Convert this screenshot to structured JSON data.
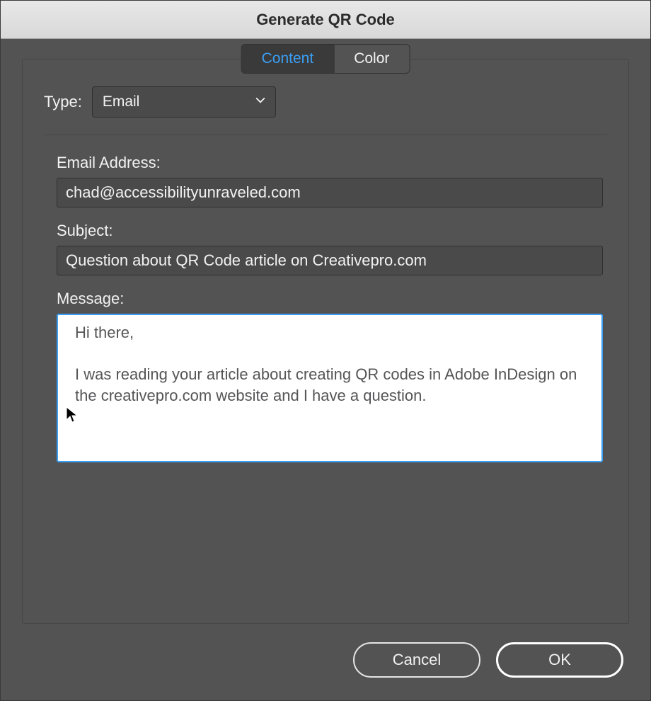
{
  "title": "Generate QR Code",
  "tabs": {
    "content": "Content",
    "color": "Color",
    "active": "content"
  },
  "type": {
    "label": "Type:",
    "selected": "Email"
  },
  "fields": {
    "emailLabel": "Email Address:",
    "emailValue": "chad@accessibilityunraveled.com",
    "subjectLabel": "Subject:",
    "subjectValue": "Question about QR Code article on Creativepro.com",
    "messageLabel": "Message:",
    "messageValue": "Hi there,\n\nI was reading your article about creating QR codes in Adobe InDesign on the creativepro.com website and I have a question."
  },
  "buttons": {
    "cancel": "Cancel",
    "ok": "OK"
  }
}
